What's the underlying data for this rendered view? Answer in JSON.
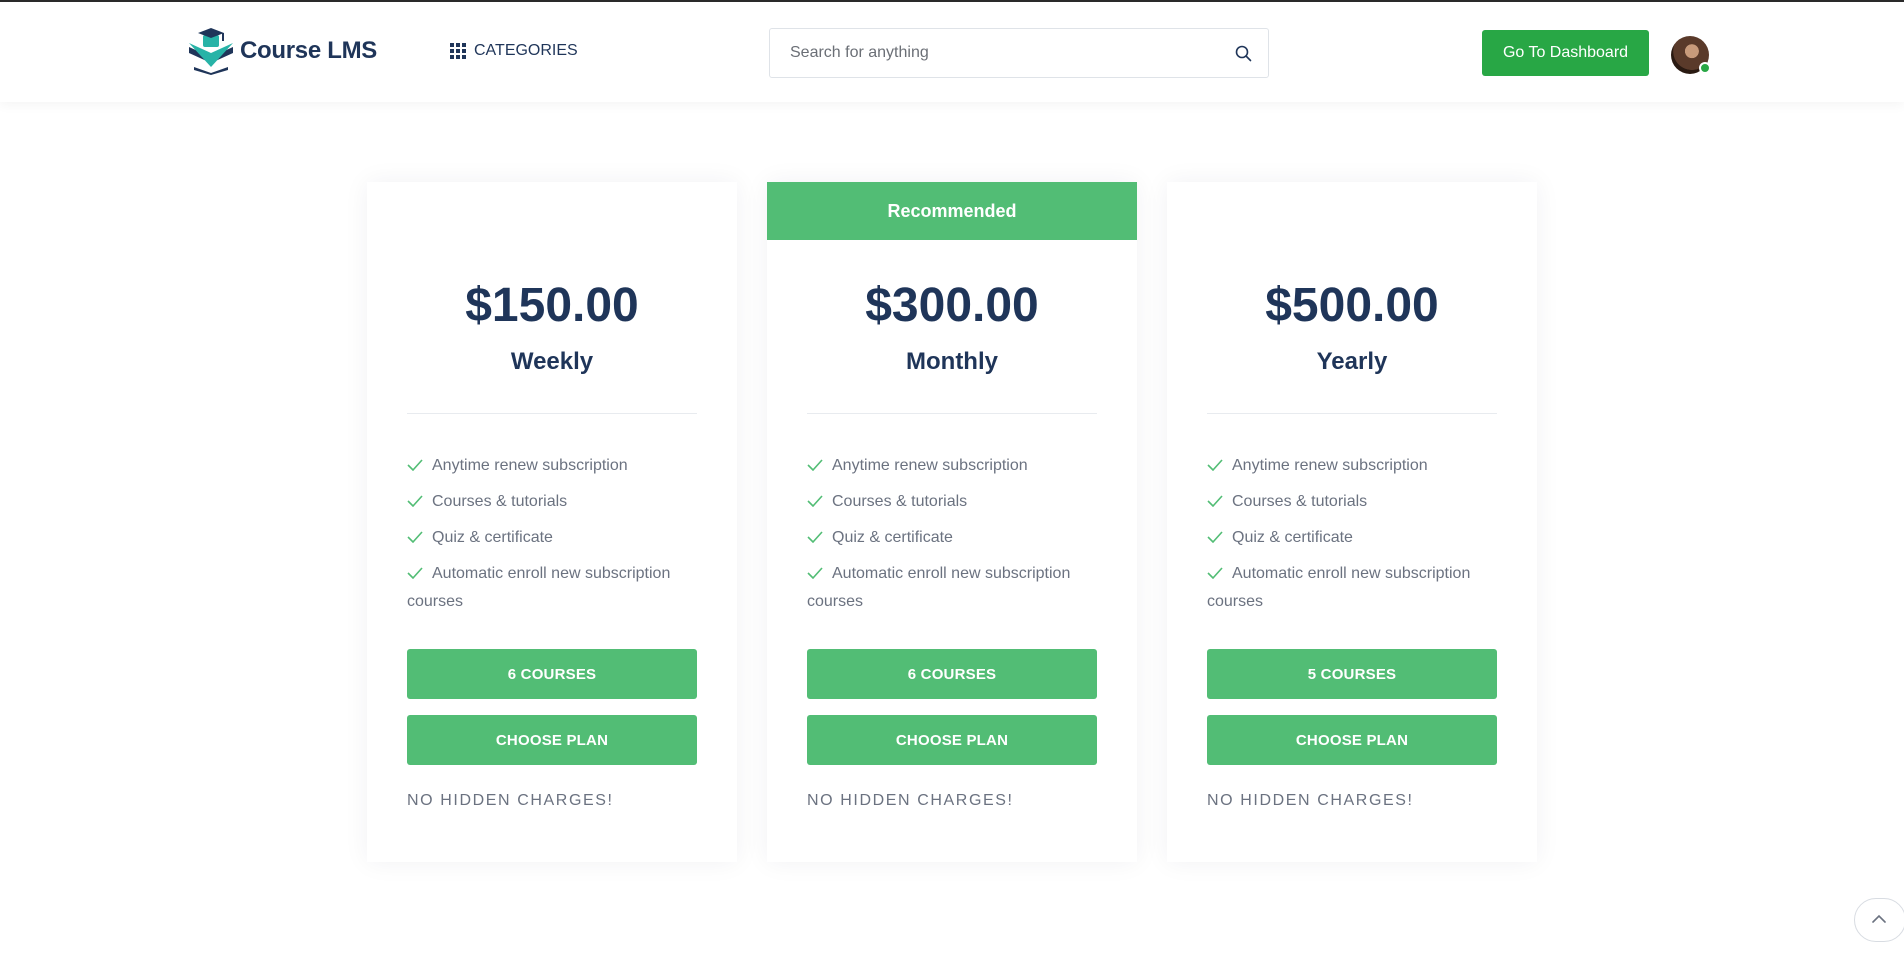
{
  "header": {
    "logo_text": "Course LMS",
    "categories_label": "CATEGORIES",
    "search_placeholder": "Search for anything",
    "dashboard_button": "Go To Dashboard",
    "colors": {
      "accent": "#28a745",
      "text": "#1f3559"
    }
  },
  "plans": [
    {
      "ribbon": "",
      "price": "$150.00",
      "period": "Weekly",
      "features": [
        "Anytime renew subscription",
        "Courses & tutorials",
        "Quiz & certificate",
        "Automatic enroll new subscription courses"
      ],
      "courses_button": "6 COURSES",
      "choose_button": "CHOOSE PLAN",
      "note": "NO HIDDEN CHARGES!"
    },
    {
      "ribbon": "Recommended",
      "price": "$300.00",
      "period": "Monthly",
      "features": [
        "Anytime renew subscription",
        "Courses & tutorials",
        "Quiz & certificate",
        "Automatic enroll new subscription courses"
      ],
      "courses_button": "6 COURSES",
      "choose_button": "CHOOSE PLAN",
      "note": "NO HIDDEN CHARGES!"
    },
    {
      "ribbon": "",
      "price": "$500.00",
      "period": "Yearly",
      "features": [
        "Anytime renew subscription",
        "Courses & tutorials",
        "Quiz & certificate",
        "Automatic enroll new subscription courses"
      ],
      "courses_button": "5 COURSES",
      "choose_button": "CHOOSE PLAN",
      "note": "NO HIDDEN CHARGES!"
    }
  ],
  "plan_colors": {
    "button": "#52bd75",
    "check": "#52bd75"
  },
  "icons": [
    "grid-icon",
    "search-icon",
    "check-icon",
    "chevron-up-icon",
    "logo-icon",
    "avatar"
  ]
}
